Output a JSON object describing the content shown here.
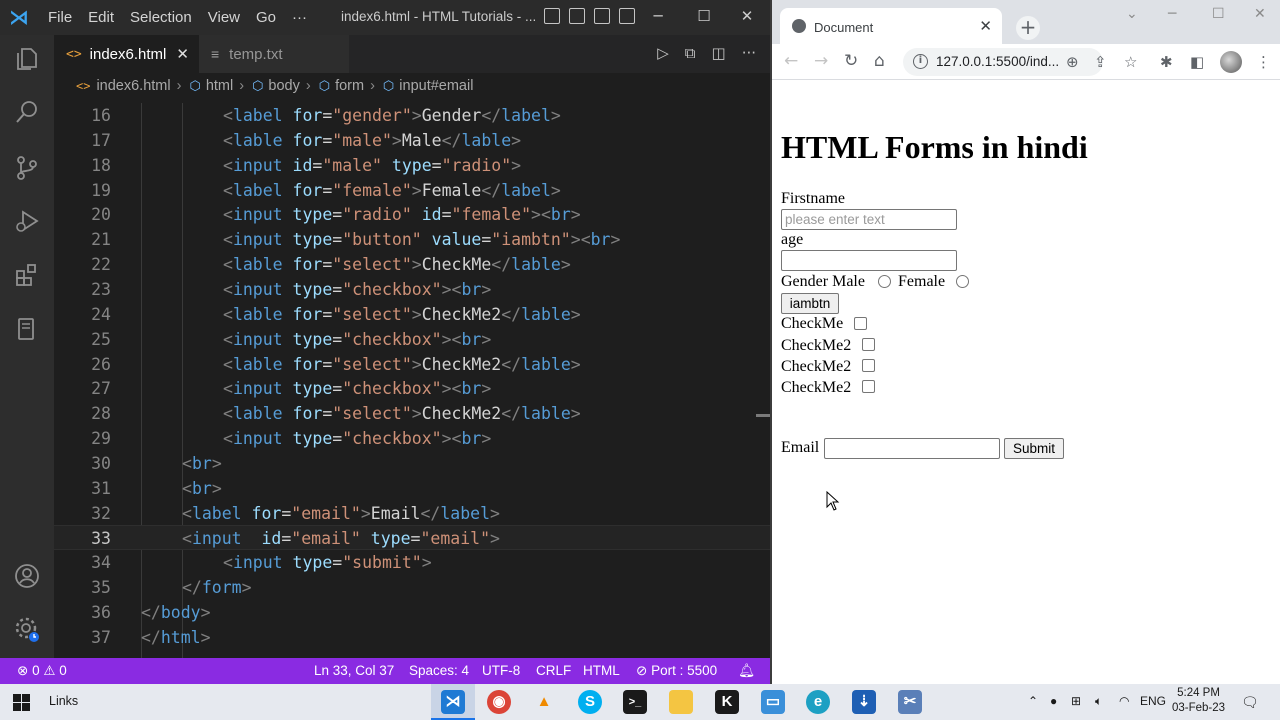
{
  "vscode": {
    "menu": [
      "File",
      "Edit",
      "Selection",
      "View",
      "Go",
      "···"
    ],
    "window_title": "index6.html - HTML Tutorials - ...",
    "tabs": [
      {
        "label": "index6.html",
        "active": true
      },
      {
        "label": "temp.txt",
        "active": false
      }
    ],
    "breadcrumb": [
      "index6.html",
      "html",
      "body",
      "form",
      "input#email"
    ],
    "code_lines": [
      {
        "n": "16",
        "indent": 2,
        "tokens": [
          [
            "b",
            "<"
          ],
          [
            "t",
            "label"
          ],
          [
            "s",
            " "
          ],
          [
            "a",
            "for"
          ],
          [
            "x",
            "="
          ],
          [
            "v",
            "\"gender\""
          ],
          [
            "b",
            ">"
          ],
          [
            "x",
            "Gender"
          ],
          [
            "b",
            "</"
          ],
          [
            "t",
            "label"
          ],
          [
            "b",
            ">"
          ]
        ]
      },
      {
        "n": "17",
        "indent": 2,
        "tokens": [
          [
            "b",
            "<"
          ],
          [
            "t",
            "lable"
          ],
          [
            "s",
            " "
          ],
          [
            "a",
            "for"
          ],
          [
            "x",
            "="
          ],
          [
            "v",
            "\"male\""
          ],
          [
            "b",
            ">"
          ],
          [
            "x",
            "Male"
          ],
          [
            "b",
            "</"
          ],
          [
            "t",
            "lable"
          ],
          [
            "b",
            ">"
          ]
        ]
      },
      {
        "n": "18",
        "indent": 2,
        "tokens": [
          [
            "b",
            "<"
          ],
          [
            "t",
            "input"
          ],
          [
            "s",
            " "
          ],
          [
            "a",
            "id"
          ],
          [
            "x",
            "="
          ],
          [
            "v",
            "\"male\""
          ],
          [
            "s",
            " "
          ],
          [
            "a",
            "type"
          ],
          [
            "x",
            "="
          ],
          [
            "v",
            "\"radio\""
          ],
          [
            "b",
            ">"
          ]
        ]
      },
      {
        "n": "19",
        "indent": 2,
        "tokens": [
          [
            "b",
            "<"
          ],
          [
            "t",
            "label"
          ],
          [
            "s",
            " "
          ],
          [
            "a",
            "for"
          ],
          [
            "x",
            "="
          ],
          [
            "v",
            "\"female\""
          ],
          [
            "b",
            ">"
          ],
          [
            "x",
            "Female"
          ],
          [
            "b",
            "</"
          ],
          [
            "t",
            "label"
          ],
          [
            "b",
            ">"
          ]
        ]
      },
      {
        "n": "20",
        "indent": 2,
        "tokens": [
          [
            "b",
            "<"
          ],
          [
            "t",
            "input"
          ],
          [
            "s",
            " "
          ],
          [
            "a",
            "type"
          ],
          [
            "x",
            "="
          ],
          [
            "v",
            "\"radio\""
          ],
          [
            "s",
            " "
          ],
          [
            "a",
            "id"
          ],
          [
            "x",
            "="
          ],
          [
            "v",
            "\"female\""
          ],
          [
            "b",
            ">"
          ],
          [
            "b",
            "<"
          ],
          [
            "t",
            "br"
          ],
          [
            "b",
            ">"
          ]
        ]
      },
      {
        "n": "21",
        "indent": 2,
        "tokens": [
          [
            "b",
            "<"
          ],
          [
            "t",
            "input"
          ],
          [
            "s",
            " "
          ],
          [
            "a",
            "type"
          ],
          [
            "x",
            "="
          ],
          [
            "v",
            "\"button\""
          ],
          [
            "s",
            " "
          ],
          [
            "a",
            "value"
          ],
          [
            "x",
            "="
          ],
          [
            "v",
            "\"iambtn\""
          ],
          [
            "b",
            ">"
          ],
          [
            "b",
            "<"
          ],
          [
            "t",
            "br"
          ],
          [
            "b",
            ">"
          ]
        ]
      },
      {
        "n": "22",
        "indent": 2,
        "tokens": [
          [
            "b",
            "<"
          ],
          [
            "t",
            "lable"
          ],
          [
            "s",
            " "
          ],
          [
            "a",
            "for"
          ],
          [
            "x",
            "="
          ],
          [
            "v",
            "\"select\""
          ],
          [
            "b",
            ">"
          ],
          [
            "x",
            "CheckMe"
          ],
          [
            "b",
            "</"
          ],
          [
            "t",
            "lable"
          ],
          [
            "b",
            ">"
          ]
        ]
      },
      {
        "n": "23",
        "indent": 2,
        "tokens": [
          [
            "b",
            "<"
          ],
          [
            "t",
            "input"
          ],
          [
            "s",
            " "
          ],
          [
            "a",
            "type"
          ],
          [
            "x",
            "="
          ],
          [
            "v",
            "\"checkbox\""
          ],
          [
            "b",
            ">"
          ],
          [
            "b",
            "<"
          ],
          [
            "t",
            "br"
          ],
          [
            "b",
            ">"
          ]
        ]
      },
      {
        "n": "24",
        "indent": 2,
        "tokens": [
          [
            "b",
            "<"
          ],
          [
            "t",
            "lable"
          ],
          [
            "s",
            " "
          ],
          [
            "a",
            "for"
          ],
          [
            "x",
            "="
          ],
          [
            "v",
            "\"select\""
          ],
          [
            "b",
            ">"
          ],
          [
            "x",
            "CheckMe2"
          ],
          [
            "b",
            "</"
          ],
          [
            "t",
            "lable"
          ],
          [
            "b",
            ">"
          ]
        ]
      },
      {
        "n": "25",
        "indent": 2,
        "tokens": [
          [
            "b",
            "<"
          ],
          [
            "t",
            "input"
          ],
          [
            "s",
            " "
          ],
          [
            "a",
            "type"
          ],
          [
            "x",
            "="
          ],
          [
            "v",
            "\"checkbox\""
          ],
          [
            "b",
            ">"
          ],
          [
            "b",
            "<"
          ],
          [
            "t",
            "br"
          ],
          [
            "b",
            ">"
          ]
        ]
      },
      {
        "n": "26",
        "indent": 2,
        "tokens": [
          [
            "b",
            "<"
          ],
          [
            "t",
            "lable"
          ],
          [
            "s",
            " "
          ],
          [
            "a",
            "for"
          ],
          [
            "x",
            "="
          ],
          [
            "v",
            "\"select\""
          ],
          [
            "b",
            ">"
          ],
          [
            "x",
            "CheckMe2"
          ],
          [
            "b",
            "</"
          ],
          [
            "t",
            "lable"
          ],
          [
            "b",
            ">"
          ]
        ]
      },
      {
        "n": "27",
        "indent": 2,
        "tokens": [
          [
            "b",
            "<"
          ],
          [
            "t",
            "input"
          ],
          [
            "s",
            " "
          ],
          [
            "a",
            "type"
          ],
          [
            "x",
            "="
          ],
          [
            "v",
            "\"checkbox\""
          ],
          [
            "b",
            ">"
          ],
          [
            "b",
            "<"
          ],
          [
            "t",
            "br"
          ],
          [
            "b",
            ">"
          ]
        ]
      },
      {
        "n": "28",
        "indent": 2,
        "tokens": [
          [
            "b",
            "<"
          ],
          [
            "t",
            "lable"
          ],
          [
            "s",
            " "
          ],
          [
            "a",
            "for"
          ],
          [
            "x",
            "="
          ],
          [
            "v",
            "\"select\""
          ],
          [
            "b",
            ">"
          ],
          [
            "x",
            "CheckMe2"
          ],
          [
            "b",
            "</"
          ],
          [
            "t",
            "lable"
          ],
          [
            "b",
            ">"
          ]
        ]
      },
      {
        "n": "29",
        "indent": 2,
        "tokens": [
          [
            "b",
            "<"
          ],
          [
            "t",
            "input"
          ],
          [
            "s",
            " "
          ],
          [
            "a",
            "type"
          ],
          [
            "x",
            "="
          ],
          [
            "v",
            "\"checkbox\""
          ],
          [
            "b",
            ">"
          ],
          [
            "b",
            "<"
          ],
          [
            "t",
            "br"
          ],
          [
            "b",
            ">"
          ]
        ]
      },
      {
        "n": "30",
        "indent": 1,
        "tokens": [
          [
            "b",
            "<"
          ],
          [
            "t",
            "br"
          ],
          [
            "b",
            ">"
          ]
        ]
      },
      {
        "n": "31",
        "indent": 1,
        "tokens": [
          [
            "b",
            "<"
          ],
          [
            "t",
            "br"
          ],
          [
            "b",
            ">"
          ]
        ]
      },
      {
        "n": "32",
        "indent": 1,
        "tokens": [
          [
            "b",
            "<"
          ],
          [
            "t",
            "label"
          ],
          [
            "s",
            " "
          ],
          [
            "a",
            "for"
          ],
          [
            "x",
            "="
          ],
          [
            "v",
            "\"email\""
          ],
          [
            "b",
            ">"
          ],
          [
            "x",
            "Email"
          ],
          [
            "b",
            "</"
          ],
          [
            "t",
            "label"
          ],
          [
            "b",
            ">"
          ]
        ]
      },
      {
        "n": "33",
        "indent": 1,
        "current": true,
        "tokens": [
          [
            "b",
            "<"
          ],
          [
            "t",
            "input"
          ],
          [
            "s",
            "  "
          ],
          [
            "a",
            "id"
          ],
          [
            "x",
            "="
          ],
          [
            "v",
            "\"email\""
          ],
          [
            "s",
            " "
          ],
          [
            "a",
            "type"
          ],
          [
            "x",
            "="
          ],
          [
            "v",
            "\"email\""
          ],
          [
            "b",
            ">"
          ]
        ]
      },
      {
        "n": "34",
        "indent": 2,
        "tokens": [
          [
            "b",
            "<"
          ],
          [
            "t",
            "input"
          ],
          [
            "s",
            " "
          ],
          [
            "a",
            "type"
          ],
          [
            "x",
            "="
          ],
          [
            "v",
            "\"submit\""
          ],
          [
            "b",
            ">"
          ]
        ]
      },
      {
        "n": "35",
        "indent": 1,
        "tokens": [
          [
            "b",
            "</"
          ],
          [
            "t",
            "form"
          ],
          [
            "b",
            ">"
          ]
        ]
      },
      {
        "n": "36",
        "indent": 0,
        "tokens": [
          [
            "b",
            "</"
          ],
          [
            "t",
            "body"
          ],
          [
            "b",
            ">"
          ]
        ]
      },
      {
        "n": "37",
        "indent": 0,
        "tokens": [
          [
            "b",
            "</"
          ],
          [
            "t",
            "html"
          ],
          [
            "b",
            ">"
          ]
        ]
      }
    ],
    "status": {
      "errors": "0",
      "warnings": "0",
      "position": "Ln 33, Col 37",
      "spaces": "Spaces: 4",
      "encoding": "UTF-8",
      "eol": "CRLF",
      "language": "HTML",
      "port": "Port : 5500"
    },
    "colors": {
      "statusbar": "#8a2be2",
      "tag": "#569cd6",
      "attr": "#9cdcfe",
      "value": "#ce9178"
    }
  },
  "browser": {
    "tab_title": "Document",
    "url": "127.0.0.1:5500/ind...",
    "page": {
      "heading": "HTML Forms in hindi",
      "firstname_label": "Firstname",
      "firstname_placeholder": "please enter text",
      "age_label": "age",
      "gender_label": "Gender",
      "male_label": "Male",
      "female_label": "Female",
      "button_value": "iambtn",
      "checkbox_labels": [
        "CheckMe",
        "CheckMe2",
        "CheckMe2",
        "CheckMe2"
      ],
      "email_label": "Email",
      "submit_label": "Submit"
    }
  },
  "taskbar": {
    "links_label": "Links",
    "language": "ENG",
    "time": "5:24 PM",
    "date": "03-Feb-23"
  }
}
